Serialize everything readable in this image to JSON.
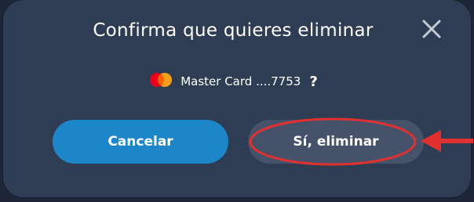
{
  "dialog": {
    "title": "Confirma que quieres eliminar",
    "close_icon": "close-icon",
    "card": {
      "brand_icon": "mastercard-icon",
      "label": "Master Card ....7753",
      "question_mark": "?"
    },
    "buttons": {
      "cancel_label": "Cancelar",
      "confirm_label": "Sí, eliminar"
    }
  },
  "annotation": {
    "highlight_color": "#e03131",
    "shape": "ellipse-around-confirm-button",
    "arrow": "pointing-left"
  },
  "colors": {
    "dialog_bg": "#2f3d54",
    "cancel_bg": "#1c86c8",
    "confirm_bg": "#45526a",
    "mc_red": "#eb001b",
    "mc_orange": "#f79e1b"
  }
}
